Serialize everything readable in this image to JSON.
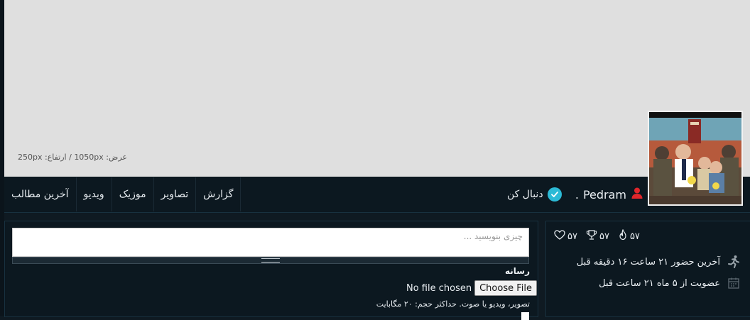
{
  "banner": {
    "dimensions_text": "عرض: 1050px / ارتفاع: 250px"
  },
  "profile": {
    "username": "Pedram",
    "separator": ".",
    "follow_label": "دنبال کن"
  },
  "tabs": [
    {
      "label": "گزارش"
    },
    {
      "label": "تصاویر"
    },
    {
      "label": "موزیک"
    },
    {
      "label": "ویدیو"
    },
    {
      "label": "آخرین مطالب"
    }
  ],
  "composer": {
    "placeholder": "چیزی بنویسید ...",
    "media_label": "رسانه",
    "file_button": "Choose File",
    "file_status": "No file chosen",
    "hint": "تصویر، ویدیو یا صوت. حداکثر حجم: ۲۰ مگابایت"
  },
  "stats": {
    "likes": "۵۷",
    "trophies": "۵۷",
    "points": "۵۷"
  },
  "info": {
    "last_seen": "آخرین حضور ۲۱ ساعت ۱۶ دقیقه قبل",
    "member_since": "عضویت از ۵ ماه ۲۱ ساعت قبل"
  },
  "colors": {
    "accent": "#2cbad6",
    "user_icon": "#e0262b",
    "background": "#0f1a22",
    "banner": "#dfdfdf"
  }
}
